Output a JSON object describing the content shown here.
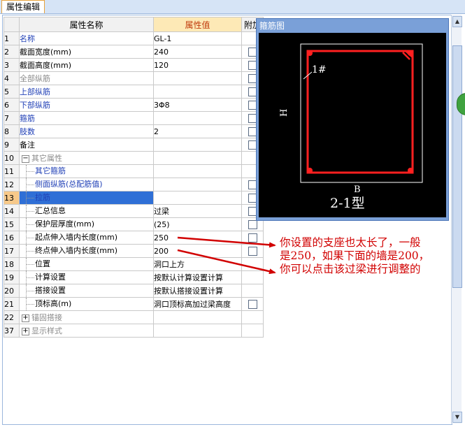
{
  "tab": {
    "label": "属性编辑"
  },
  "grid": {
    "headers": {
      "name": "属性名称",
      "value": "属性值",
      "attach": "附加"
    },
    "rows": [
      {
        "num": "1",
        "name": "名称",
        "value": "GL-1",
        "cls": "blue",
        "checkbox": false
      },
      {
        "num": "2",
        "name": "截面宽度(mm)",
        "value": "240",
        "cls": "blk",
        "checkbox": true
      },
      {
        "num": "3",
        "name": "截面高度(mm)",
        "value": "120",
        "cls": "blk",
        "checkbox": true
      },
      {
        "num": "4",
        "name": "全部纵筋",
        "value": "",
        "cls": "gray",
        "checkbox": true
      },
      {
        "num": "5",
        "name": "上部纵筋",
        "value": "",
        "cls": "blue",
        "checkbox": true
      },
      {
        "num": "6",
        "name": "下部纵筋",
        "value": "3Φ8",
        "cls": "blue",
        "checkbox": true
      },
      {
        "num": "7",
        "name": "箍筋",
        "value": "",
        "cls": "blue",
        "checkbox": true
      },
      {
        "num": "8",
        "name": "肢数",
        "value": "2",
        "cls": "blue",
        "checkbox": true
      },
      {
        "num": "9",
        "name": "备注",
        "value": "",
        "cls": "blk",
        "checkbox": true
      },
      {
        "num": "10",
        "name": "其它属性",
        "value": "",
        "cls": "gray",
        "checkbox": false,
        "expander": "−"
      },
      {
        "num": "11",
        "name": "其它箍筋",
        "value": "",
        "cls": "blue",
        "checkbox": false,
        "child": true
      },
      {
        "num": "12",
        "name": "侧面纵筋(总配筋值)",
        "value": "",
        "cls": "blue",
        "checkbox": true,
        "child": true
      },
      {
        "num": "13",
        "name": "拉筋",
        "value": "",
        "cls": "blue",
        "checkbox": true,
        "child": true,
        "selected": true
      },
      {
        "num": "14",
        "name": "汇总信息",
        "value": "过梁",
        "cls": "blk",
        "checkbox": true,
        "child": true
      },
      {
        "num": "15",
        "name": "保护层厚度(mm)",
        "value": "(25)",
        "cls": "blk",
        "checkbox": true,
        "child": true
      },
      {
        "num": "16",
        "name": "起点伸入墙内长度(mm)",
        "value": "250",
        "cls": "blk",
        "checkbox": true,
        "child": true
      },
      {
        "num": "17",
        "name": "终点伸入墙内长度(mm)",
        "value": "200",
        "cls": "blk",
        "checkbox": true,
        "child": true
      },
      {
        "num": "18",
        "name": "位置",
        "value": "洞口上方",
        "cls": "blk",
        "checkbox": false,
        "child": true
      },
      {
        "num": "19",
        "name": "计算设置",
        "value": "按默认计算设置计算",
        "cls": "blk",
        "checkbox": false,
        "child": true
      },
      {
        "num": "20",
        "name": "搭接设置",
        "value": "按默认搭接设置计算",
        "cls": "blk",
        "checkbox": false,
        "child": true
      },
      {
        "num": "21",
        "name": "顶标高(m)",
        "value": "洞口顶标高加过梁高度",
        "cls": "blk",
        "checkbox": true,
        "child": true
      },
      {
        "num": "22",
        "name": "锚固搭接",
        "value": "",
        "cls": "gray",
        "checkbox": false,
        "expander": "+"
      },
      {
        "num": "37",
        "name": "显示样式",
        "value": "",
        "cls": "gray",
        "checkbox": false,
        "expander": "+"
      }
    ]
  },
  "popup": {
    "title": "箍筋图",
    "label_rebar": "1#",
    "label_h": "H",
    "label_b": "B",
    "label_type": "2-1型"
  },
  "annotation": {
    "lines": [
      "你设置的支座也太长了，一般",
      "是250，如果下面的墙是200，",
      "你可以点击该过梁进行调整的"
    ],
    "color": "#d10000"
  },
  "colors": {
    "accent": "#2f6fd6",
    "note": "#d10000",
    "rebar": "#ff2020"
  }
}
